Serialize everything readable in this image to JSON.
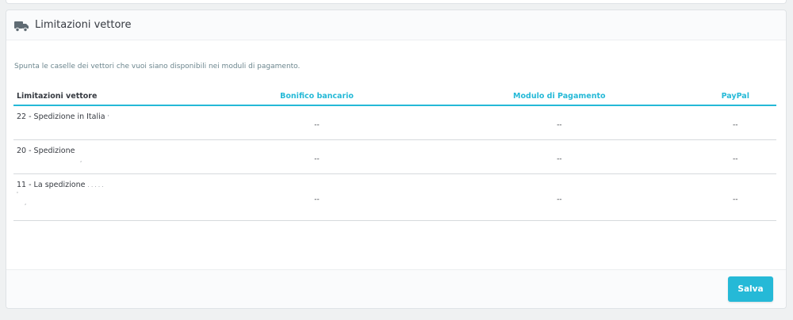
{
  "panel": {
    "title": "Limitazioni vettore",
    "icon": "truck-icon",
    "description": "Spunta le caselle dei vettori che vuoi siano disponibili nei moduli di pagamento."
  },
  "table": {
    "headers": [
      "Limitazioni vettore",
      "Bonifico bancario",
      "Modulo di Pagamento",
      "PayPal"
    ],
    "rows": [
      {
        "name": "22 - Spedizione in Italia",
        "values": [
          "--",
          "--",
          "--"
        ]
      },
      {
        "name": "20 - Spedizione",
        "values": [
          "--",
          "--",
          "--"
        ]
      },
      {
        "name": "11 - La spedizione",
        "values": [
          "--",
          "--",
          "--"
        ]
      }
    ]
  },
  "footer": {
    "save_label": "Salva"
  },
  "colors": {
    "accent": "#25b9d7",
    "text": "#363a41",
    "muted": "#6c868e"
  }
}
